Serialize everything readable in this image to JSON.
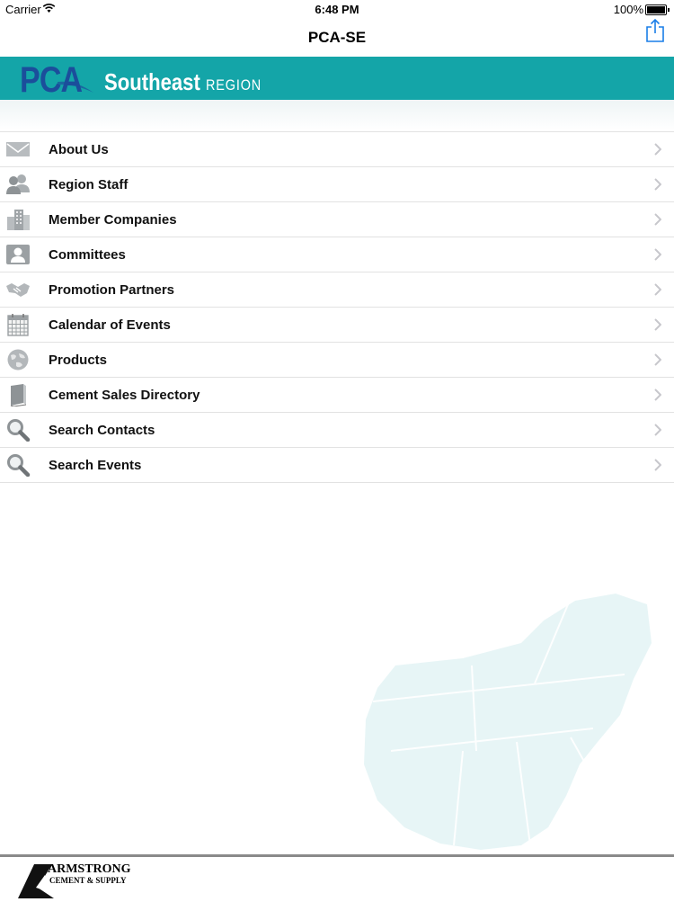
{
  "status": {
    "carrier": "Carrier",
    "time": "6:48 PM",
    "battery": "100%",
    "battery_level": 1.0
  },
  "nav": {
    "title": "PCA-SE"
  },
  "banner": {
    "logo": "PCA",
    "region": "Southeast",
    "region_suffix": "REGION"
  },
  "menu": [
    {
      "label": "About Us",
      "icon": "envelope-icon"
    },
    {
      "label": "Region Staff",
      "icon": "people-icon"
    },
    {
      "label": "Member Companies",
      "icon": "buildings-icon"
    },
    {
      "label": "Committees",
      "icon": "contact-card-icon"
    },
    {
      "label": "Promotion Partners",
      "icon": "handshake-icon"
    },
    {
      "label": "Calendar of Events",
      "icon": "calendar-icon"
    },
    {
      "label": "Products",
      "icon": "globe-icon"
    },
    {
      "label": "Cement Sales Directory",
      "icon": "book-icon"
    },
    {
      "label": "Search Contacts",
      "icon": "magnifier-icon"
    },
    {
      "label": "Search Events",
      "icon": "magnifier-icon"
    }
  ],
  "footer": {
    "sponsor_name": "ARMSTRONG",
    "sponsor_sub": "CEMENT & SUPPLY"
  }
}
